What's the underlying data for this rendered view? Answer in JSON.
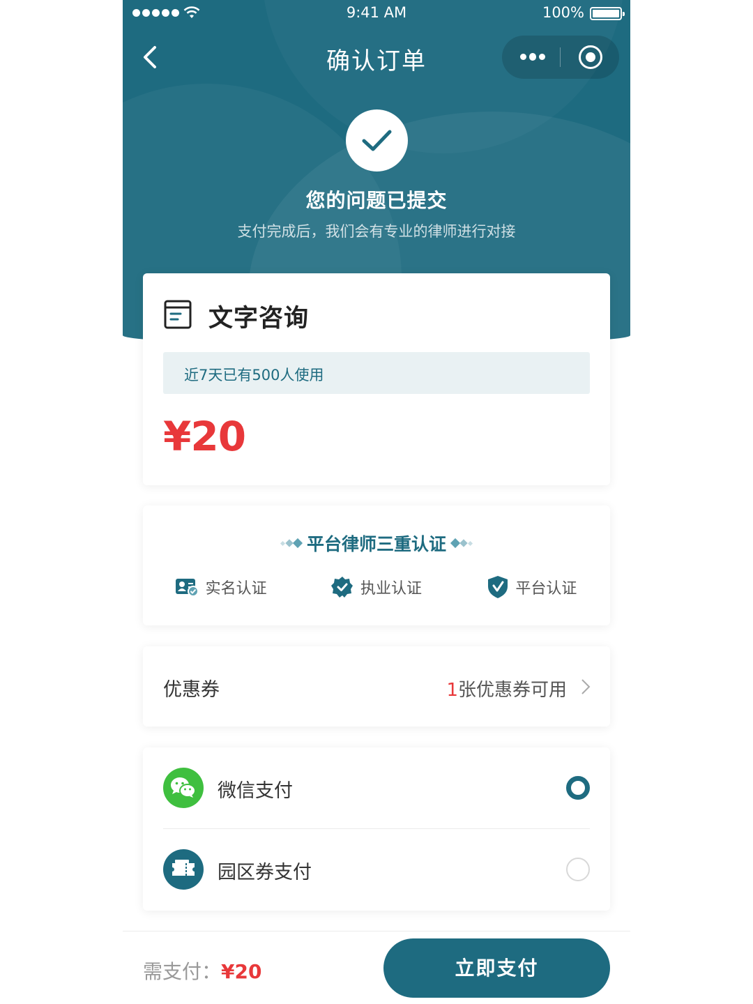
{
  "status_bar": {
    "time": "9:41 AM",
    "battery": "100%"
  },
  "nav": {
    "title": "确认订单"
  },
  "hero": {
    "title": "您的问题已提交",
    "subtitle": "支付完成后，我们会有专业的律师进行对接"
  },
  "service": {
    "name": "文字咨询",
    "usage": "近7天已有500人使用",
    "price": "¥20"
  },
  "certification": {
    "title": "平台律师三重认证",
    "items": [
      {
        "label": "实名认证",
        "icon": "id-card-icon"
      },
      {
        "label": "执业认证",
        "icon": "verified-badge-icon"
      },
      {
        "label": "平台认证",
        "icon": "shield-check-icon"
      }
    ]
  },
  "coupon": {
    "label": "优惠券",
    "count": "1",
    "available": "张优惠券可用"
  },
  "payment": {
    "methods": [
      {
        "name": "微信支付",
        "selected": true,
        "icon": "wechat-icon",
        "color": "#3fbf3f"
      },
      {
        "name": "园区券支付",
        "selected": false,
        "icon": "ticket-icon",
        "color": "#1e6b80"
      }
    ]
  },
  "footer": {
    "need_label": "需支付：",
    "amount": "¥20",
    "pay_button": "立即支付"
  },
  "colors": {
    "primary": "#1e6b80",
    "price": "#e8383a",
    "wechat": "#3fbf3f"
  }
}
